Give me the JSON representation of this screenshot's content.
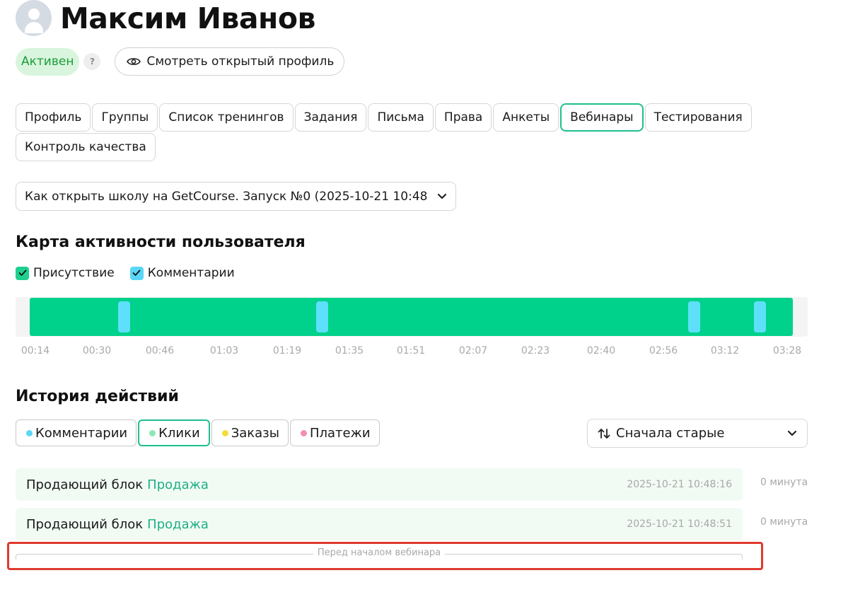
{
  "header": {
    "name": "Максим Иванов",
    "status": "Активен",
    "help": "?",
    "public_profile_label": "Смотреть открытый профиль"
  },
  "tabs": [
    {
      "label": "Профиль",
      "active": false
    },
    {
      "label": "Группы",
      "active": false
    },
    {
      "label": "Список тренингов",
      "active": false
    },
    {
      "label": "Задания",
      "active": false
    },
    {
      "label": "Письма",
      "active": false
    },
    {
      "label": "Права",
      "active": false
    },
    {
      "label": "Анкеты",
      "active": false
    },
    {
      "label": "Вебинары",
      "active": true
    },
    {
      "label": "Тестирования",
      "active": false
    },
    {
      "label": "Контроль качества",
      "active": false
    }
  ],
  "webinar_select": {
    "value": "Как открыть школу на GetCourse. Запуск №0 (2025-10-21 10:48)"
  },
  "activity_map": {
    "title": "Карта активности пользователя",
    "checks": [
      {
        "label": "Присутствие",
        "checked": true,
        "color": "#1fcf8f"
      },
      {
        "label": "Комментарии",
        "checked": true,
        "color": "#5ad6f7"
      }
    ],
    "presence_color": "#00d18b",
    "comment_color": "#5ee0fb",
    "ticks": [
      "00:14",
      "00:30",
      "00:46",
      "01:03",
      "01:19",
      "01:35",
      "01:51",
      "02:07",
      "02:23",
      "02:40",
      "02:56",
      "03:12",
      "03:28"
    ]
  },
  "history": {
    "title": "История действий",
    "filters": [
      {
        "label": "Комментарии",
        "color": "#5ad6f7",
        "active": false
      },
      {
        "label": "Клики",
        "color": "#8ee8b6",
        "active": true
      },
      {
        "label": "Заказы",
        "color": "#f5dc3c",
        "active": false
      },
      {
        "label": "Платежи",
        "color": "#f48fb1",
        "active": false
      }
    ],
    "sort_label": "Сначала старые",
    "rows": [
      {
        "text": "Продающий блок",
        "link": "Продажа",
        "timestamp": "2025-10-21 10:48:16",
        "duration": "0 минута"
      },
      {
        "text": "Продающий блок",
        "link": "Продажа",
        "timestamp": "2025-10-21 10:48:51",
        "duration": "0 минута"
      }
    ],
    "separator_label": "Перед началом вебинара"
  },
  "accent_color": "#1fbf8f",
  "highlight_color": "#e03a2f"
}
